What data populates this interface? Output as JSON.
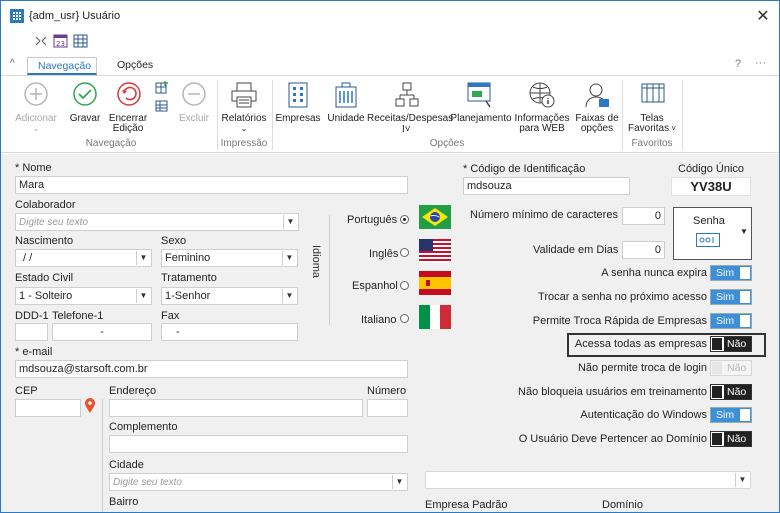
{
  "window": {
    "title": "{adm_usr}  Usuário"
  },
  "tabs": [
    {
      "label": "Navegação",
      "active": true
    },
    {
      "label": "Opções",
      "active": false
    }
  ],
  "topright": {
    "help": "?",
    "dots": "···"
  },
  "ribbon": {
    "buttons": {
      "adicionar": "Adicionar",
      "gravar": "Gravar",
      "encerrar": "Encerrar Edição",
      "excluir": "Excluir",
      "relatorios": "Relatórios",
      "empresas": "Empresas",
      "unidade": "Unidade",
      "receitas": "Receitas/Despesas",
      "planejamento": "Planejamento",
      "informacoes": "Informações para WEB",
      "faixas": "Faixas de opções",
      "telas": "Telas Favoritas"
    },
    "groups": {
      "navegacao": "Navegação",
      "impressao": "Impressão",
      "opcoes": "Opções",
      "favoritos": "Favoritos"
    }
  },
  "form": {
    "nome_label": "* Nome",
    "nome_value": "Mara",
    "colaborador_label": "Colaborador",
    "colaborador_placeholder": "Digite seu texto",
    "nascimento_label": "Nascimento",
    "nascimento_value": "/ /",
    "sexo_label": "Sexo",
    "sexo_value": "Feminino",
    "estado_civil_label": "Estado Civil",
    "estado_civil_value": "1 - Solteiro",
    "tratamento_label": "Tratamento",
    "tratamento_value": "1-Senhor",
    "ddd_label": "DDD-1",
    "telefone_label": "Telefone-1",
    "telefone_value": "-",
    "fax_label": "Fax",
    "fax_value": "-",
    "email_label": "* e-mail",
    "email_value": "mdsouza@starsoft.com.br",
    "cep_label": "CEP",
    "endereco_label": "Endereço",
    "numero_label": "Número",
    "complemento_label": "Complemento",
    "cidade_label": "Cidade",
    "cidade_placeholder": "Digite seu texto",
    "bairro_label": "Bairro"
  },
  "idioma": {
    "label": "Idioma",
    "options": [
      {
        "label": "Português",
        "selected": true
      },
      {
        "label": "Inglês",
        "selected": false
      },
      {
        "label": "Espanhol",
        "selected": false
      },
      {
        "label": "Italiano",
        "selected": false
      }
    ]
  },
  "right": {
    "codigo_label": "* Código de Identificação",
    "codigo_value": "mdsouza",
    "codigo_unico_label": "Código Único",
    "codigo_unico_value": "YV38U",
    "min_chars_label": "Número mínimo de caracteres",
    "min_chars_value": "0",
    "validade_label": "Validade em Dias",
    "validade_value": "0",
    "senha_label": "Senha",
    "toggles": [
      {
        "label": "A senha nunca expira",
        "value": "Sim",
        "state": "on"
      },
      {
        "label": "Trocar a senha no próximo  acesso",
        "value": "Sim",
        "state": "on"
      },
      {
        "label": "Permite Troca Rápida de Empresas",
        "value": "Sim",
        "state": "on"
      },
      {
        "label": "Acessa todas as empresas",
        "value": "Não",
        "state": "off"
      },
      {
        "label": "Não permite troca de login",
        "value": "Não",
        "state": "disabled"
      },
      {
        "label": "Não bloqueia usuários em treinamento",
        "value": "Não",
        "state": "off"
      },
      {
        "label": "Autenticação do Windows",
        "value": "Sim",
        "state": "on"
      },
      {
        "label": "O Usuário Deve Pertencer ao Domínio",
        "value": "Não",
        "state": "off"
      }
    ],
    "empresa_padrao_label": "Empresa Padrão",
    "dominio_label": "Domínio"
  },
  "colors": {
    "accent": "#2b78c5",
    "toggle_on": "#3c8fd8",
    "content_bg": "#f0f0f0"
  }
}
